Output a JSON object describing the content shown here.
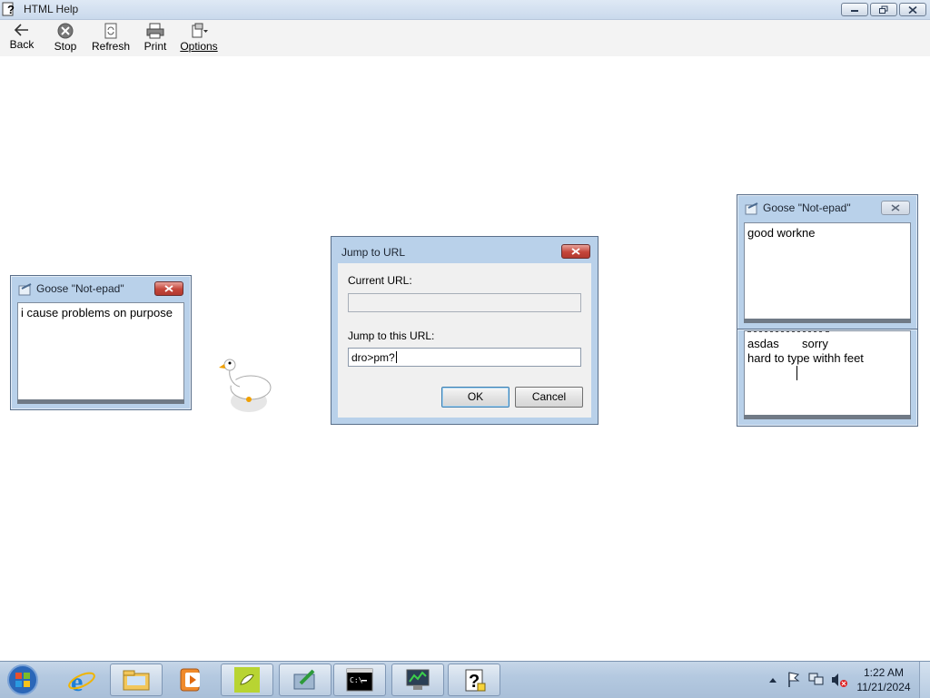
{
  "window": {
    "title": "HTML Help",
    "controls": [
      "minimize",
      "restore",
      "close"
    ]
  },
  "toolbar": {
    "buttons": [
      {
        "label": "Back",
        "icon": "back-arrow-icon"
      },
      {
        "label": "Stop",
        "icon": "stop-icon"
      },
      {
        "label": "Refresh",
        "icon": "refresh-icon"
      },
      {
        "label": "Print",
        "icon": "printer-icon"
      },
      {
        "label": "Options",
        "icon": "options-icon"
      }
    ]
  },
  "notepad_left": {
    "title": "Goose \"Not-epad\"",
    "text": "i cause problems on purpose"
  },
  "notepad_right_top": {
    "title": "Goose \"Not-epad\"",
    "text": "good workne"
  },
  "notepad_right_bottom": {
    "text_line1": "asdas       sorry",
    "text_line2": "hard to type withh feet"
  },
  "dialog": {
    "title": "Jump to URL",
    "current_url_label": "Current URL:",
    "current_url_value": "",
    "jump_label": "Jump to this URL:",
    "jump_value": "dro>pm?",
    "ok_label": "OK",
    "cancel_label": "Cancel"
  },
  "taskbar": {
    "items": [
      "start-orb",
      "internet-explorer",
      "file-explorer",
      "media-player",
      "goose-app",
      "notepad-app",
      "command-prompt",
      "network-app",
      "html-help"
    ],
    "time": "1:22 AM",
    "date": "11/21/2024"
  },
  "colors": {
    "window_frame": "#b9d1ea",
    "close_red": "#c4453a",
    "taskbar": "#b4c9e0"
  }
}
